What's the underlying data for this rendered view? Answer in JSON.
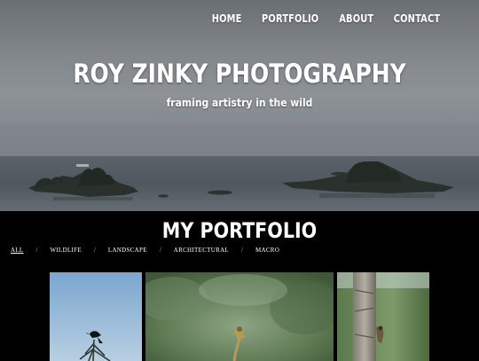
{
  "nav": {
    "items": [
      "HOME",
      "PORTFOLIO",
      "ABOUT",
      "CONTACT"
    ]
  },
  "hero": {
    "title": "ROY ZINKY PHOTOGRAPHY",
    "tagline": "framing artistry in the wild"
  },
  "portfolio": {
    "title": "MY PORTFOLIO",
    "filters": [
      "ALL",
      "WILDLIFE",
      "LANDSCAPE",
      "ARCHITECTURAL",
      "MACRO"
    ],
    "active_filter": "ALL",
    "separator": "/"
  },
  "gallery": {
    "tiles": [
      {
        "subject": "bird-on-treetop-photo"
      },
      {
        "subject": "bird-in-forest-photo"
      },
      {
        "subject": "woodpecker-on-trunk-photo"
      }
    ]
  }
}
